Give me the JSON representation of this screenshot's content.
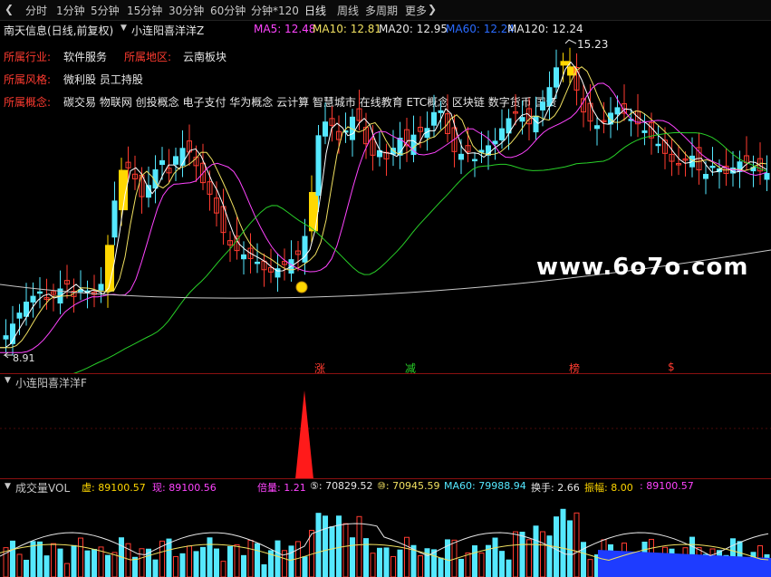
{
  "toolbar": {
    "collapse_icon": "chevron-left-icon",
    "items": [
      "分时",
      "1分钟",
      "5分钟",
      "15分钟",
      "30分钟",
      "60分钟",
      "分钟*120",
      "日线",
      "周线",
      "多周期",
      "更多"
    ],
    "active": "日线",
    "more_icon": "chevron-right-icon"
  },
  "header": {
    "stock": "南天信息(日线,前复权)",
    "indicator": "小连阳喜洋洋Z",
    "ma5": "MA5: 12.48",
    "ma10": "MA10: 12.81",
    "ma20": "MA20: 12.95",
    "ma60": "MA60: 12.24",
    "ma120": "MA120: 12.24"
  },
  "info": {
    "industry_label": "所属行业:",
    "industry": "软件服务",
    "region_label": "所属地区:",
    "region": "云南板块",
    "style_label": "所属风格:",
    "style": "微利股 员工持股",
    "concept_label": "所属概念:",
    "concepts": "碳交易 物联网 创投概念 电子支付 华为概念 云计算 智慧城市 在线教育 ETC概念 区块链 数字货币 国资"
  },
  "price_panel": {
    "high_label": "15.23",
    "low_label": "8.91",
    "signals": [
      {
        "text": "涨",
        "color": "#ff3b30"
      },
      {
        "text": "减",
        "color": "#28d028"
      },
      {
        "text": "榜",
        "color": "#ff3b30"
      },
      {
        "text": "$",
        "color": "#ff3b30"
      }
    ],
    "colors": {
      "up": "#55e8ff",
      "down": "#ff3b30",
      "limit": "#ffd700",
      "ma5": "#ffffff",
      "ma10": "#f0e060",
      "ma20": "#ff44ff",
      "ma60": "#28d028",
      "ma120": "#c8c8c8"
    }
  },
  "watermark": "www.6o7o.com",
  "signal_panel": {
    "title": "小连阳喜洋洋F"
  },
  "volume_panel": {
    "title": "成交量VOL",
    "xu": "虚: 89100.57",
    "xian": "现: 89100.56",
    "beiliang": "倍量: 1.21",
    "v5": "⑤: 70829.52",
    "v10": "⑩: 70945.59",
    "ma60": "MA60: 79988.94",
    "huanshou": "换手: 2.66",
    "zhenfu": "振幅: 8.00",
    "last": ": 89100.57"
  }
}
